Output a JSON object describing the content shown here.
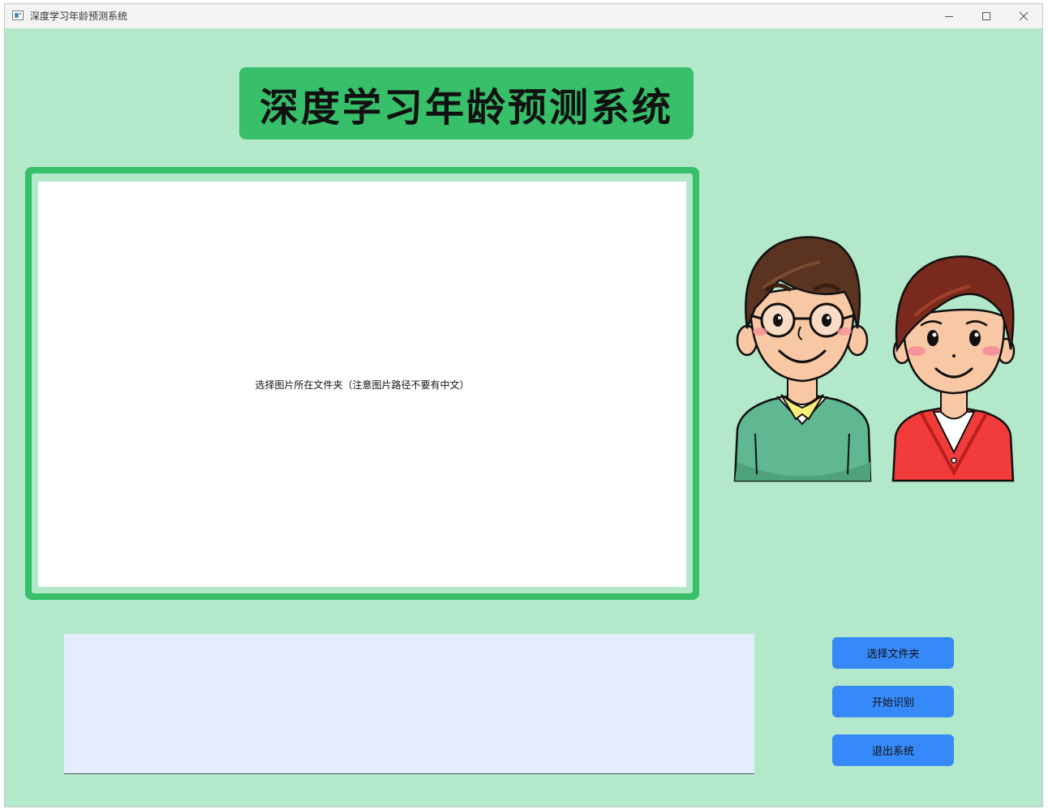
{
  "window": {
    "title": "深度学习年龄预测系统",
    "icon": "app-window-icon",
    "controls": [
      "minimize-icon",
      "maximize-icon",
      "close-icon"
    ]
  },
  "header": {
    "title": "深度学习年龄预测系统"
  },
  "image_panel": {
    "placeholder": "选择图片所在文件夹（注意图片路径不要有中文）"
  },
  "illustration": {
    "figures": [
      "man-with-glasses-avatar",
      "woman-avatar"
    ]
  },
  "result_panel": {
    "text": ""
  },
  "buttons": {
    "select_folder": "选择文件夹",
    "start_recognition": "开始识别",
    "exit_system": "退出系统"
  },
  "colors": {
    "background": "#b3e8cb",
    "accent_green": "#37bf6a",
    "button_blue": "#3689f8",
    "result_bg": "#e4edfb"
  }
}
